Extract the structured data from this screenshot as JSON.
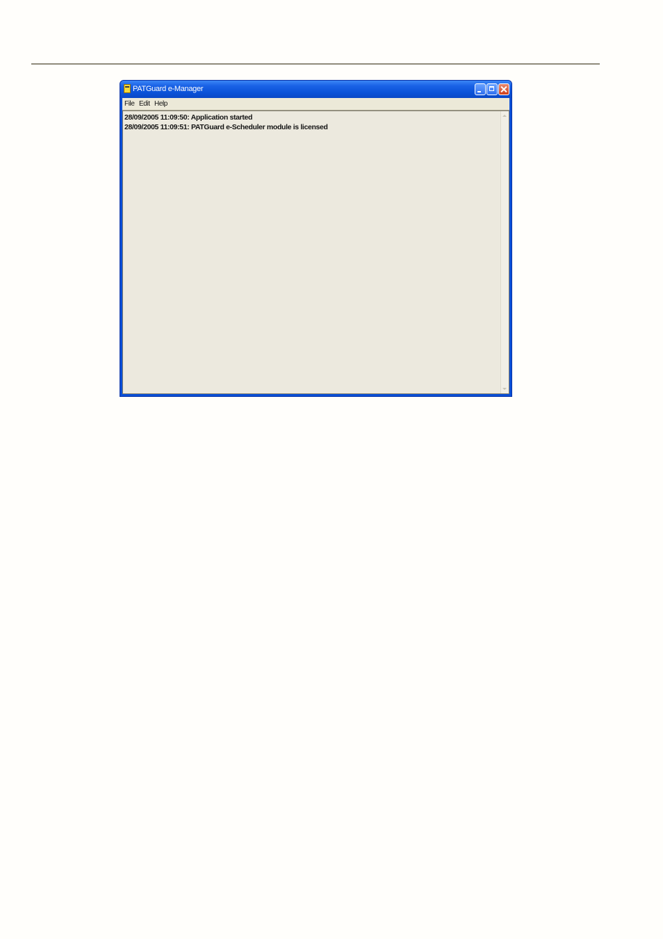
{
  "window": {
    "title": "PATGuard e-Manager",
    "icons": {
      "app": "app-icon",
      "minimize": "minimize-icon",
      "maximize": "maximize-icon",
      "close": "close-icon"
    }
  },
  "menu": {
    "items": [
      {
        "label": "File"
      },
      {
        "label": "Edit"
      },
      {
        "label": "Help"
      }
    ]
  },
  "log": {
    "entries": [
      "28/09/2005 11:09:50: Application started",
      "28/09/2005 11:09:51: PATGuard e-Scheduler module is licensed"
    ]
  },
  "colors": {
    "titlebar": "#0a52d8",
    "client_background": "#ece9de",
    "close_button": "#d0411c"
  }
}
